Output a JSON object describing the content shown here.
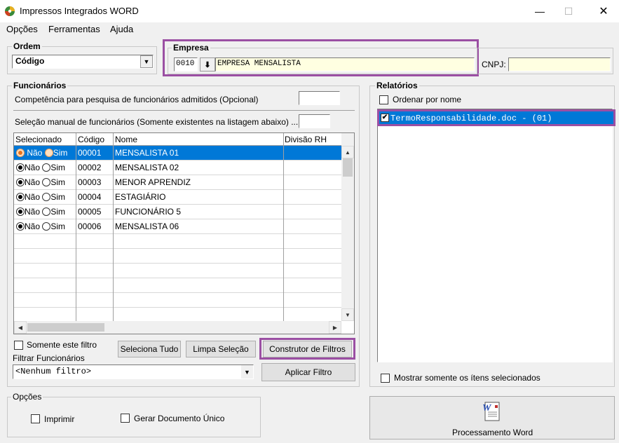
{
  "window": {
    "title": "Impressos Integrados WORD",
    "minimize_glyph": "—",
    "maximize_glyph": "☐",
    "close_glyph": "✕"
  },
  "menu": [
    "Opções",
    "Ferramentas",
    "Ajuda"
  ],
  "ordem": {
    "legend": "Ordem",
    "selected": "Código"
  },
  "empresa": {
    "legend": "Empresa",
    "code": "0010",
    "name": "EMPRESA MENSALISTA",
    "cnpj_label": "CNPJ:",
    "cnpj_value": ""
  },
  "funcionarios": {
    "legend": "Funcionários",
    "competencia_label": "Competência para pesquisa de funcionários admitidos (Opcional)",
    "competencia_value": "",
    "selecao_label": "Seleção manual de funcionários (Somente existentes na listagem abaixo) ...",
    "selecao_value": "",
    "columns": [
      "Selecionado",
      "Código",
      "Nome",
      "Divisão RH"
    ],
    "radio_nao": "Não",
    "radio_sim": "Sim",
    "rows": [
      {
        "codigo": "00001",
        "nome": "MENSALISTA 01",
        "divisao": ""
      },
      {
        "codigo": "00002",
        "nome": "MENSALISTA 02",
        "divisao": ""
      },
      {
        "codigo": "00003",
        "nome": "MENOR APRENDIZ",
        "divisao": ""
      },
      {
        "codigo": "00004",
        "nome": "ESTAGIÁRIO",
        "divisao": ""
      },
      {
        "codigo": "00005",
        "nome": "FUNCIONÁRIO 5",
        "divisao": ""
      },
      {
        "codigo": "00006",
        "nome": "MENSALISTA 06",
        "divisao": ""
      }
    ],
    "somente_filtro_label": "Somente este filtro",
    "filtrar_label": "Filtrar Funcionários",
    "filtro_selected": "<Nenhum filtro>",
    "btn_seleciona_tudo": "Seleciona Tudo",
    "btn_limpa_selecao": "Limpa Seleção",
    "btn_construtor": "Construtor de Filtros",
    "btn_aplicar": "Aplicar Filtro"
  },
  "relatorios": {
    "legend": "Relatórios",
    "ordenar_label": "Ordenar por nome",
    "items": [
      "TermoResponsabilidade.doc - (01)"
    ],
    "mostrar_label": "Mostrar somente os ítens selecionados"
  },
  "opcoes": {
    "legend": "Opções",
    "imprimir_label": "Imprimir",
    "gerar_label": "Gerar Documento Único"
  },
  "processamento": {
    "label": "Processamento Word"
  },
  "colors": {
    "highlight_frame": "#9b4fa3",
    "selection": "#0078d7",
    "input_yellow": "#ffffe1"
  }
}
